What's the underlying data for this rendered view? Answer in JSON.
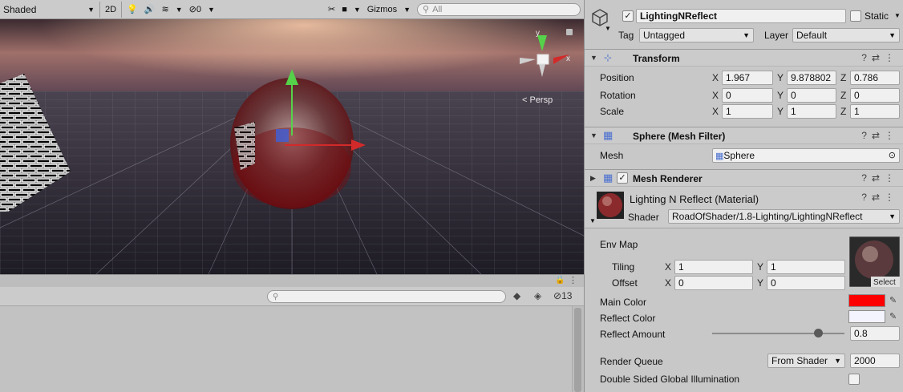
{
  "scene": {
    "shading_mode": "Shaded",
    "mode_2d": "2D",
    "hidden_count": "0",
    "gizmos_label": "Gizmos",
    "search_placeholder": "All",
    "persp_label": "< Persp",
    "gizmo_axes": {
      "y": "y",
      "x": "x"
    }
  },
  "bottom_panel": {
    "hidden_count": "13"
  },
  "inspector": {
    "object": {
      "active": true,
      "name": "LightingNReflect",
      "static_label": "Static",
      "tag_label": "Tag",
      "tag_value": "Untagged",
      "layer_label": "Layer",
      "layer_value": "Default"
    },
    "transform": {
      "title": "Transform",
      "position": {
        "label": "Position",
        "x": "1.967",
        "y": "9.878802",
        "z": "0.786"
      },
      "rotation": {
        "label": "Rotation",
        "x": "0",
        "y": "0",
        "z": "0"
      },
      "scale": {
        "label": "Scale",
        "x": "1",
        "y": "1",
        "z": "1"
      },
      "axis_labels": {
        "x": "X",
        "y": "Y",
        "z": "Z"
      }
    },
    "mesh_filter": {
      "title": "Sphere (Mesh Filter)",
      "mesh_label": "Mesh",
      "mesh_value": "Sphere"
    },
    "mesh_renderer": {
      "title": "Mesh Renderer",
      "enabled": true
    },
    "material": {
      "name": "Lighting N Reflect (Material)",
      "shader_label": "Shader",
      "shader_value": "RoadOfShader/1.8-Lighting/LightingNReflect",
      "env_map_label": "Env Map",
      "tiling_label": "Tiling",
      "tiling_x": "1",
      "tiling_y": "1",
      "offset_label": "Offset",
      "offset_x": "0",
      "offset_y": "0",
      "select_label": "Select",
      "main_color_label": "Main Color",
      "main_color": "#ff0000",
      "reflect_color_label": "Reflect Color",
      "reflect_color": "#f4f4ff",
      "reflect_amount_label": "Reflect Amount",
      "reflect_amount": "0.8",
      "render_queue_label": "Render Queue",
      "render_queue_mode": "From Shader",
      "render_queue_value": "2000",
      "dsgi_label": "Double Sided Global Illumination"
    }
  }
}
